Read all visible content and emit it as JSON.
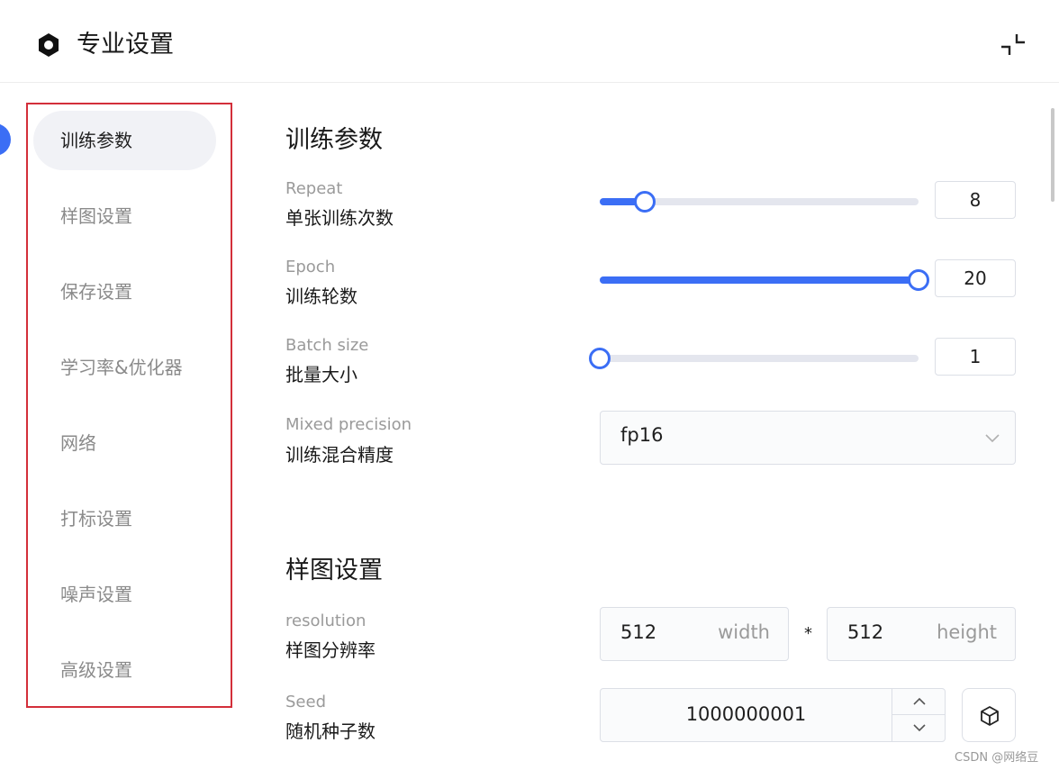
{
  "header": {
    "title": "专业设置",
    "icon": "nut-icon",
    "collapse_icon": "collapse-icon"
  },
  "sidebar": {
    "items": [
      {
        "label": "训练参数",
        "active": true
      },
      {
        "label": "样图设置",
        "active": false
      },
      {
        "label": "保存设置",
        "active": false
      },
      {
        "label": "学习率&优化器",
        "active": false
      },
      {
        "label": "网络",
        "active": false
      },
      {
        "label": "打标设置",
        "active": false
      },
      {
        "label": "噪声设置",
        "active": false
      },
      {
        "label": "高级设置",
        "active": false
      }
    ]
  },
  "training": {
    "title": "训练参数",
    "repeat": {
      "en": "Repeat",
      "cn": "单张训练次数",
      "value": "8",
      "fill_fraction": 0.14
    },
    "epoch": {
      "en": "Epoch",
      "cn": "训练轮数",
      "value": "20",
      "fill_fraction": 1.0
    },
    "batch": {
      "en": "Batch size",
      "cn": "批量大小",
      "value": "1",
      "fill_fraction": 0.0
    },
    "precision": {
      "en": "Mixed precision",
      "cn": "训练混合精度",
      "value": "fp16"
    }
  },
  "sample": {
    "title": "样图设置",
    "resolution": {
      "en": "resolution",
      "cn": "样图分辨率",
      "width": "512",
      "width_label": "width",
      "separator": "*",
      "height": "512",
      "height_label": "height"
    },
    "seed": {
      "en": "Seed",
      "cn": "随机种子数",
      "value": "1000000001"
    }
  },
  "watermark": "CSDN @网络豆",
  "colors": {
    "accent": "#3b6ef5",
    "highlight_border": "#d32f3a"
  }
}
